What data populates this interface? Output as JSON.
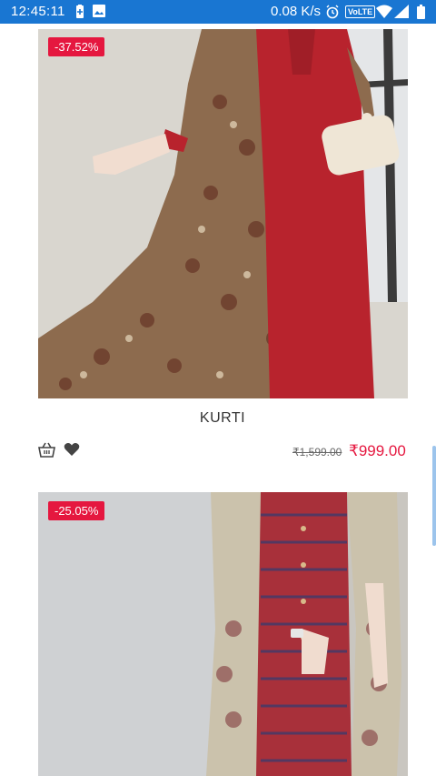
{
  "status_bar": {
    "time": "12:45:11",
    "network_speed": "0.08 K/s",
    "volte_label": "VoLTE",
    "background": "#1976d2"
  },
  "products": [
    {
      "discount": "-37.52%",
      "name": "KURTI",
      "old_price": "₹1,599.00",
      "new_price": "₹999.00"
    },
    {
      "discount": "-25.05%"
    }
  ],
  "icons": {
    "cart": "basket-icon",
    "wishlist": "heart-icon"
  },
  "colors": {
    "accent": "#e5173f"
  }
}
